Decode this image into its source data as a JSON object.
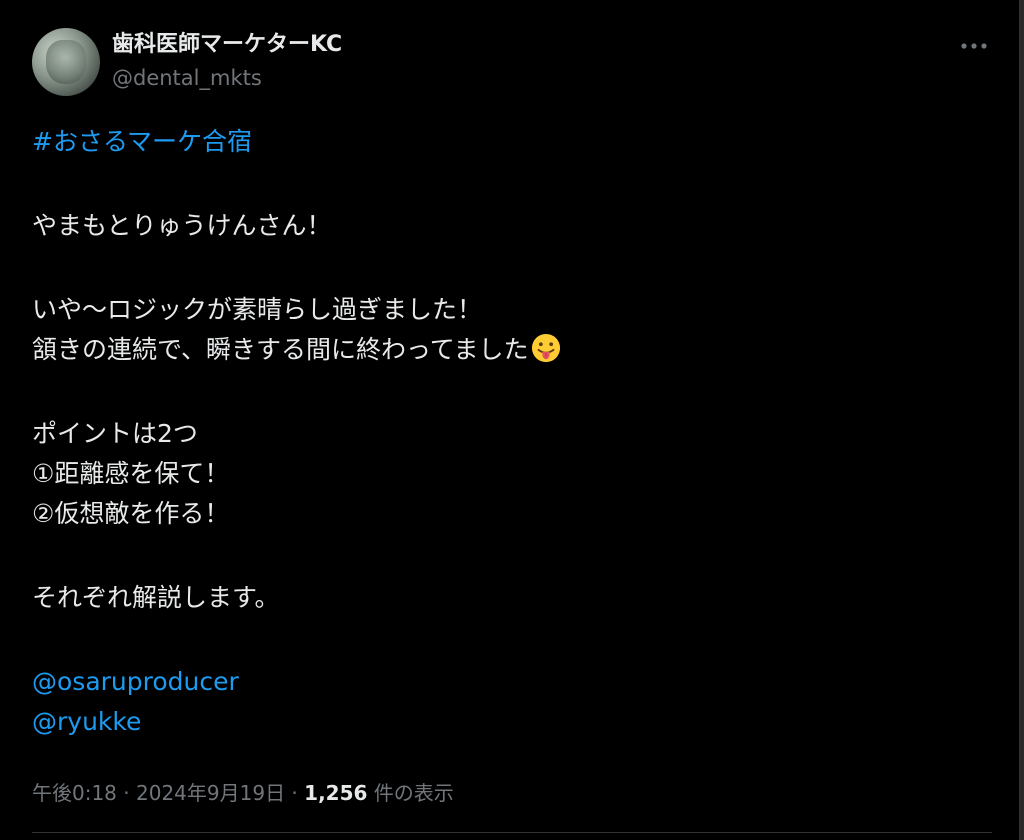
{
  "colors": {
    "background": "#000000",
    "text_primary": "#e7e9ea",
    "text_secondary": "#71767b",
    "link": "#1d9bf0"
  },
  "author": {
    "display_name": "歯科医師マーケターKC",
    "handle": "@dental_mkts",
    "avatar_icon": "profile-photo"
  },
  "more_menu_icon": "more-horizontal-icon",
  "tweet": {
    "hashtag": "#おさるマーケ合宿",
    "line_1": "やまもとりゅうけんさん！",
    "line_2": "いや〜ロジックが素晴らし過ぎました！",
    "line_3": "頷きの連続で、瞬きする間に終わってました",
    "line_3_emoji": "face-with-tongue-emoji",
    "line_4": "ポイントは2つ",
    "line_5": "①距離感を保て！",
    "line_6": "②仮想敵を作る！",
    "line_7": "それぞれ解説します。",
    "mention_1": "@osaruproducer",
    "mention_2": "@ryukke"
  },
  "meta": {
    "time": "午後0:18",
    "separator": " · ",
    "date": "2024年9月19日",
    "views_count": "1,256",
    "views_label": " 件の表示"
  }
}
